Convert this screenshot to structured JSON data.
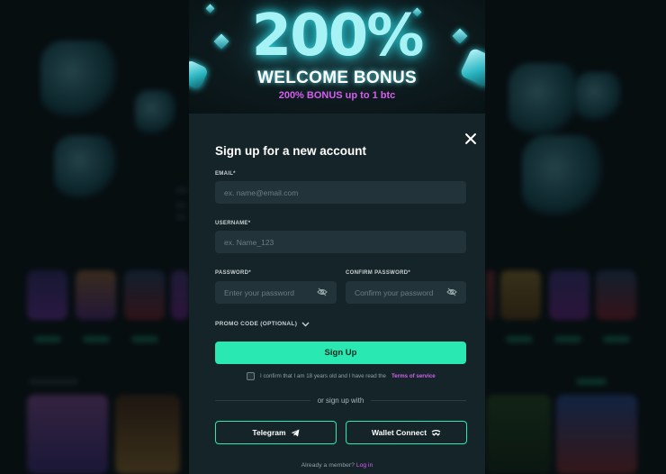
{
  "banner": {
    "big_text": "200%",
    "title": "WELCOME BONUS",
    "subtitle": "200% BONUS up to 1 btc"
  },
  "form": {
    "title": "Sign up for a new account",
    "email_label": "EMAIL*",
    "email_placeholder": "ex. name@email.com",
    "username_label": "USERNAME*",
    "username_placeholder": "ex. Name_123",
    "password_label": "PASSWORD*",
    "password_placeholder": "Enter your password",
    "confirm_label": "CONFIRM PASSWORD*",
    "confirm_placeholder": "Confirm your password",
    "promo_label": "PROMO CODE (OPTIONAL)",
    "signup_label": "Sign Up",
    "confirm_text": "I confirm that I am 18 years old and I have read the",
    "tos_link": "Terms of service",
    "or_text": "or sign up with",
    "telegram_label": "Telegram",
    "wallet_label": "Wallet Connect",
    "member_text": "Already a member?",
    "login_link": "Log in"
  },
  "colors": {
    "accent": "#2ae8b1",
    "link": "#d75ef0",
    "panel": "#152429",
    "input_bg": "#22343a"
  },
  "icons": [
    "close-icon",
    "eye-slash-icon",
    "chevron-down-icon",
    "telegram-icon",
    "wallet-connect-icon"
  ]
}
